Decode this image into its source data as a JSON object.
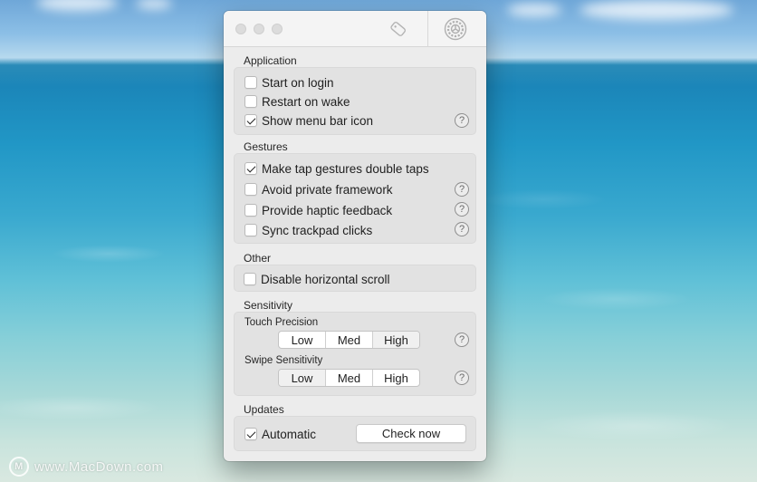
{
  "window": {
    "sections": {
      "application": {
        "title": "Application",
        "start_on_login": {
          "label": "Start on login",
          "checked": false
        },
        "restart_on_wake": {
          "label": "Restart on wake",
          "checked": false
        },
        "show_menu_bar_icon": {
          "label": "Show menu bar icon",
          "checked": true
        }
      },
      "gestures": {
        "title": "Gestures",
        "double_taps": {
          "label": "Make tap gestures double taps",
          "checked": true
        },
        "avoid_private": {
          "label": "Avoid private framework",
          "checked": false
        },
        "haptic": {
          "label": "Provide haptic feedback",
          "checked": false
        },
        "sync_clicks": {
          "label": "Sync trackpad clicks",
          "checked": false
        }
      },
      "other": {
        "title": "Other",
        "disable_hscroll": {
          "label": "Disable horizontal scroll",
          "checked": false
        }
      },
      "sensitivity": {
        "title": "Sensitivity",
        "touch_precision": {
          "label": "Touch Precision",
          "options": [
            "Low",
            "Med",
            "High"
          ],
          "selected": "High"
        },
        "swipe_sensitivity": {
          "label": "Swipe Sensitivity",
          "options": [
            "Low",
            "Med",
            "High"
          ],
          "selected": "Low"
        }
      },
      "updates": {
        "title": "Updates",
        "automatic": {
          "label": "Automatic",
          "checked": true
        },
        "check_now_label": "Check now"
      }
    },
    "help_glyph": "?"
  },
  "watermark": {
    "logo_glyph": "M",
    "text": "www.MacDown.com"
  },
  "icons": {
    "titlebar_left": "trackpad-tag-icon",
    "titlebar_right": "settings-gear-icon"
  }
}
